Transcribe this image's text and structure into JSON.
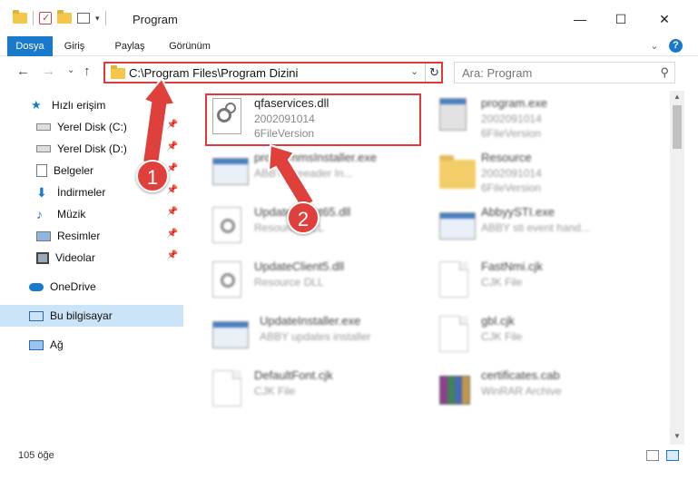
{
  "window": {
    "title": "Program"
  },
  "title_buttons": {
    "minimize": "—",
    "maximize": "☐",
    "close": "✕"
  },
  "ribbon": {
    "tabs": [
      "Dosya",
      "Giriş",
      "Paylaş",
      "Görünüm"
    ],
    "help": "?",
    "expand": "⌄"
  },
  "nav": {
    "back": "←",
    "forward": "→",
    "recent": "⌄",
    "up": "↑"
  },
  "address": {
    "path": "C:\\Program Files\\Program Dizini",
    "dropdown": "⌄",
    "refresh": "↻"
  },
  "search": {
    "placeholder": "Ara: Program",
    "icon": "search-icon"
  },
  "sidebar": {
    "quick_access": "Hızlı erişim",
    "items": [
      {
        "label": "Yerel Disk (C:)",
        "icon": "drive-icon",
        "pinned": true
      },
      {
        "label": "Yerel Disk (D:)",
        "icon": "drive-icon",
        "pinned": true
      },
      {
        "label": "Belgeler",
        "icon": "documents-icon",
        "pinned": true
      },
      {
        "label": "İndirmeler",
        "icon": "download-icon",
        "pinned": true
      },
      {
        "label": "Müzik",
        "icon": "music-icon",
        "pinned": true
      },
      {
        "label": "Resimler",
        "icon": "pictures-icon",
        "pinned": true
      },
      {
        "label": "Videolar",
        "icon": "videos-icon",
        "pinned": true
      }
    ],
    "onedrive": "OneDrive",
    "this_pc": "Bu bilgisayar",
    "network": "Ağ"
  },
  "files": [
    {
      "name": "qfaservices.dll",
      "line1": "2002091014",
      "line2": "6FileVersion",
      "icon": "gear-file-icon",
      "highlighted": true
    },
    {
      "name": "program.exe",
      "line1": "2002091014",
      "line2": "6FileVersion",
      "icon": "installer-icon"
    },
    {
      "name": "programmsInstaller.exe",
      "line1": "ABBY fineeader In...",
      "line2": "",
      "icon": "window-exe-icon"
    },
    {
      "name": "Resource",
      "line1": "2002091014",
      "line2": "6FileVersion",
      "icon": "folder-icon"
    },
    {
      "name": "UpdateClient65.dll",
      "line1": "Resource DLL",
      "line2": "",
      "icon": "gear-file-icon"
    },
    {
      "name": "AbbyySTI.exe",
      "line1": "ABBY sti event hand...",
      "line2": "",
      "icon": "window-exe-icon"
    },
    {
      "name": "UpdateClient5.dll",
      "line1": "Resource DLL",
      "line2": "",
      "icon": "gear-file-icon"
    },
    {
      "name": "FastNmi.cjk",
      "line1": "CJK File",
      "line2": "",
      "icon": "blank-file-icon"
    },
    {
      "name": "UpdateInstaller.exe",
      "line1": "ABBY updates installer",
      "line2": "",
      "icon": "window-exe-icon"
    },
    {
      "name": "gbl.cjk",
      "line1": "CJK File",
      "line2": "",
      "icon": "blank-file-icon"
    },
    {
      "name": "DefaultFont.cjk",
      "line1": "CJK File",
      "line2": "",
      "icon": "blank-file-icon"
    },
    {
      "name": "certificates.cab",
      "line1": "WinRAR Archive",
      "line2": "",
      "icon": "rar-archive-icon"
    }
  ],
  "callouts": [
    "1",
    "2"
  ],
  "status": {
    "count": "105 öğe"
  },
  "colors": {
    "accent": "#1979ca",
    "highlight_border": "#e03b3b",
    "selection": "#cce4f7",
    "callout": "#e0403b"
  }
}
